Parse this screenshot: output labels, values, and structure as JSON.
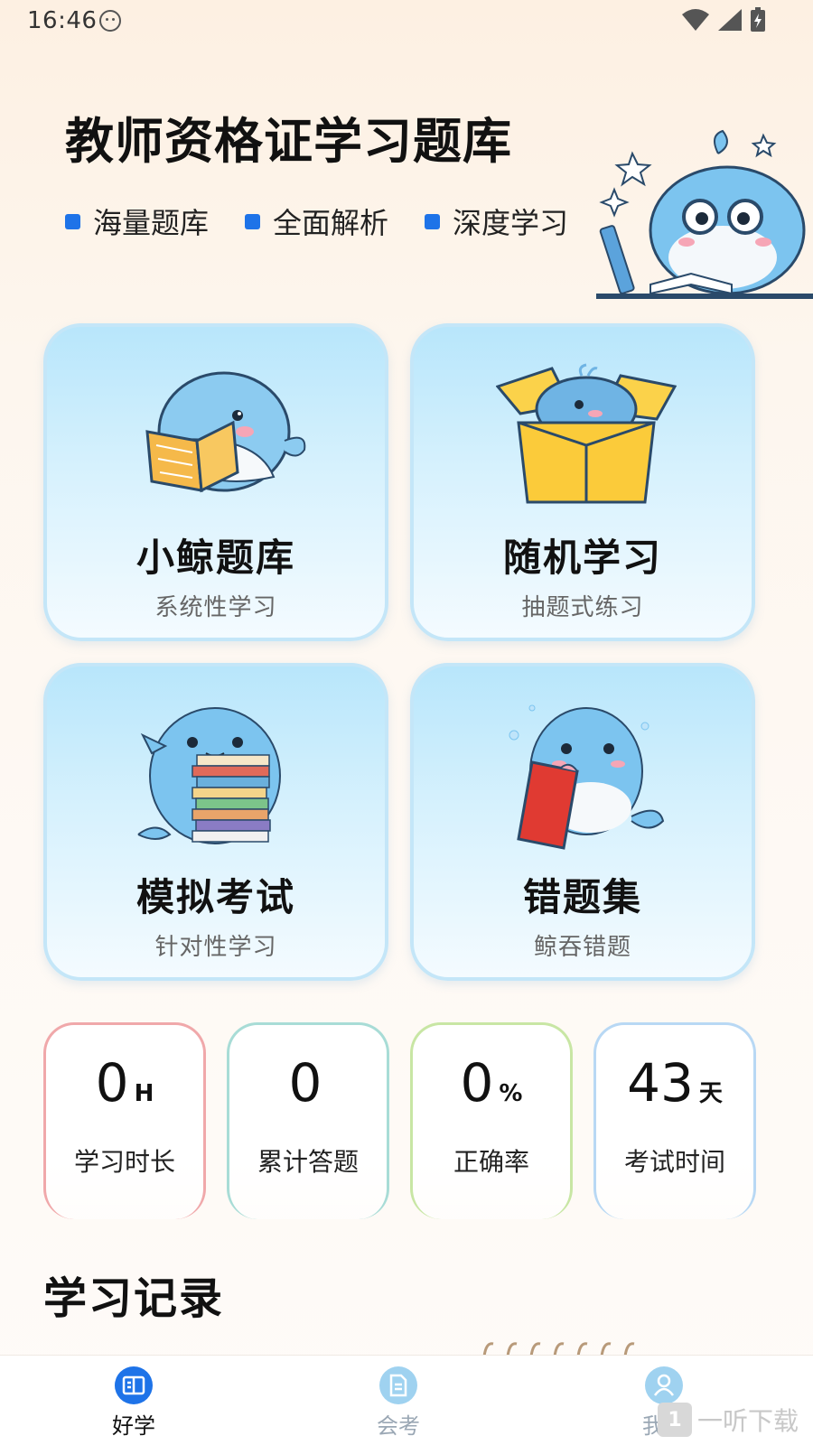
{
  "status_bar": {
    "time": "16:46"
  },
  "hero": {
    "title": "教师资格证学习题库",
    "features": [
      "海量题库",
      "全面解析",
      "深度学习"
    ]
  },
  "cards": [
    {
      "title": "小鲸题库",
      "subtitle": "系统性学习",
      "icon": "whale-reading-book-icon"
    },
    {
      "title": "随机学习",
      "subtitle": "抽题式练习",
      "icon": "whale-in-box-icon"
    },
    {
      "title": "模拟考试",
      "subtitle": "针对性学习",
      "icon": "whale-hugging-books-icon"
    },
    {
      "title": "错题集",
      "subtitle": "鲸吞错题",
      "icon": "whale-eating-book-icon"
    }
  ],
  "stats": [
    {
      "value": "0",
      "unit": "H",
      "label": "学习时长",
      "border_color": "#f0a8aa"
    },
    {
      "value": "0",
      "unit": "",
      "label": "累计答题",
      "border_color": "#a8dcd6"
    },
    {
      "value": "0",
      "unit": "%",
      "label": "正确率",
      "border_color": "#c8e6a4"
    },
    {
      "value": "43",
      "unit": "天",
      "label": "考试时间",
      "border_color": "#b8d8f4"
    }
  ],
  "section": {
    "title": "学习记录"
  },
  "nav": [
    {
      "label": "好学",
      "icon": "book-icon",
      "active": true
    },
    {
      "label": "会考",
      "icon": "document-icon",
      "active": false
    },
    {
      "label": "我的",
      "icon": "user-icon",
      "active": false
    }
  ],
  "watermark": {
    "text": "一听下载"
  },
  "colors": {
    "accent": "#1e73e8",
    "nav_active": "#1e73e8",
    "nav_inactive": "#9fd2f0"
  }
}
